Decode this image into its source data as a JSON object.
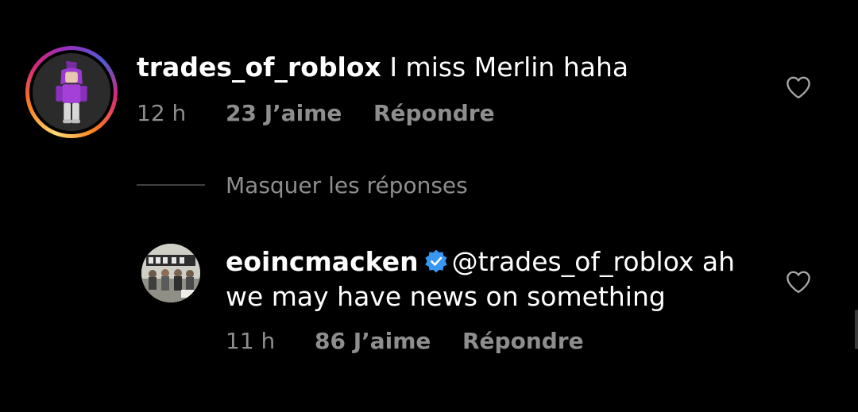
{
  "comments": [
    {
      "username": "trades_of_roblox",
      "text": "I miss Merlin haha",
      "time": "12 h",
      "likes": "23 J’aime",
      "reply_label": "Répondre",
      "avatar_icon": "roblox-avatar",
      "has_story_ring": true
    }
  ],
  "hide_replies_label": "Masquer les réponses",
  "replies": [
    {
      "username": "eoincmacken",
      "verified": true,
      "text": "@trades_of_roblox ah we may have news on something",
      "time": "11 h",
      "likes": "86 J’aime",
      "reply_label": "Répondre",
      "avatar_icon": "group-photo-avatar"
    }
  ],
  "colors": {
    "background": "#000000",
    "primary_text": "#ffffff",
    "secondary_text": "#8e8e8e",
    "verified_blue": "#3897f0"
  }
}
